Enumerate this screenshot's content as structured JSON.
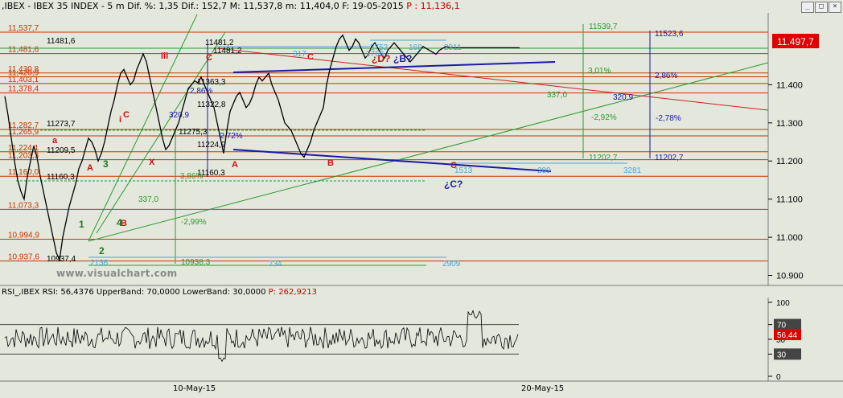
{
  "header": {
    "prefix": ",IBEX - IBEX 35 INDEX - 5 m Dif. %: 1,35 Dif.: 152,7 M: 11,537,8 m: 11,404,0 F: 19-05-2015",
    "last": "P : 11,136,1"
  },
  "window_controls": [
    "_",
    "□",
    "×"
  ],
  "watermark": "www.visualchart.com",
  "colors": {
    "background": "#e3e7dc",
    "price_line": "#000000",
    "support_lines": "#cc3300",
    "blue_lines": "#1a1aa8",
    "green_lines": "#2f9a2f",
    "red_trend": "#d02020",
    "cyan_lines": "#4aa6d8",
    "price_badge": "#e00000"
  },
  "price_axis": {
    "ticks": [
      11.4,
      11.3,
      11.2,
      11.1,
      11.0,
      10.9
    ],
    "tick_labels": [
      "11.400",
      "11.300",
      "11.200",
      "11.100",
      "11.000",
      "10.900"
    ],
    "current_price": "11.497,7"
  },
  "rsi_header": {
    "prefix": "RSI_,IBEX RSI: 56,4376 UpperBand: 70,0000 LowerBand: 30,0000",
    "last": "P: 262,9213"
  },
  "rsi_axis": {
    "ticks": [
      100,
      70,
      50,
      30,
      0
    ],
    "tick_labels": [
      "100",
      "70",
      "50",
      "30",
      "0"
    ],
    "badges": [
      "70",
      "56,44",
      "30"
    ]
  },
  "x_axis": {
    "labels": [
      "10-May-15",
      "20-May-15"
    ]
  },
  "horizontal_levels": [
    {
      "label": "11,537,7",
      "value": 11537.7
    },
    {
      "label": "11,481,6",
      "value": 11481.6
    },
    {
      "label": "11,420,9",
      "value": 11420.9
    },
    {
      "label": "11,430,8",
      "value": 11430.8
    },
    {
      "label": "11,403,1",
      "value": 11403.1
    },
    {
      "label": "11,378,4",
      "value": 11378.4
    },
    {
      "label": "11,282,7",
      "value": 11282.7
    },
    {
      "label": "11,265,9",
      "value": 11265.9
    },
    {
      "label": "11,224,1",
      "value": 11224.1
    },
    {
      "label": "11,203,3",
      "value": 11203.3
    },
    {
      "label": "11,160,0",
      "value": 11160.0
    },
    {
      "label": "11,073,3",
      "value": 11073.3
    },
    {
      "label": "10,994,9",
      "value": 10994.9
    },
    {
      "label": "10,937,6",
      "value": 10937.6
    }
  ],
  "annotations": {
    "black_values": [
      "11481,6",
      "11273,7",
      "11209,5",
      "11160,3",
      "10937,4",
      "11481,2",
      "11363,3",
      "11322,8",
      "11224,9",
      "11160,3",
      "11275,3",
      "11481,2"
    ],
    "wave_labels_red": [
      "A",
      "B",
      "C",
      "C",
      "B",
      "C",
      "A",
      "C",
      "iii",
      "i",
      "a",
      "X"
    ],
    "wave_labels_green": [
      "1",
      "2",
      "3",
      "4"
    ],
    "question_labels": [
      "¿D?",
      "¿B?",
      "¿C?"
    ],
    "percent_labels": [
      "3,01%",
      "2,86%",
      "-2,92%",
      "-2,78%",
      "-2,99%",
      "3,86%",
      "-2,72%",
      "2,86%"
    ],
    "measure_values": [
      "337,0",
      "320,9",
      "337,0",
      "320,9",
      "2752",
      "169",
      "2911",
      "2769",
      "734",
      "2909",
      "317",
      "289",
      "3281",
      "1513",
      "2136"
    ],
    "range_top_right": [
      "11539,7",
      "11523,6"
    ],
    "range_bottom_right": [
      "11202,7",
      "11202,7"
    ],
    "range_bottom_left": [
      "10938,3"
    ]
  },
  "chart_data": {
    "type": "line",
    "title": "IBEX 35 INDEX 5 m",
    "xlabel": "",
    "ylabel": "",
    "ylim": [
      10880,
      11580
    ],
    "grid": false,
    "price_series": {
      "name": "IBEX",
      "x": [
        0,
        4,
        8,
        12,
        16,
        20,
        24,
        28,
        32,
        36,
        40,
        44,
        48,
        52,
        56,
        60,
        64,
        68,
        72,
        76,
        80,
        84,
        88,
        92,
        96,
        100,
        104,
        108,
        112,
        116,
        120,
        124,
        128,
        132,
        136,
        140,
        144,
        148,
        152,
        156,
        160,
        164,
        168,
        172,
        176,
        180,
        184,
        188,
        192,
        196,
        200,
        204,
        208,
        212,
        216,
        220,
        224,
        228,
        232,
        236,
        240,
        244,
        248,
        252,
        256,
        260,
        264,
        268,
        272,
        276,
        280,
        284,
        288,
        292,
        296,
        300,
        304,
        308,
        312,
        316,
        320,
        324,
        328,
        332,
        336,
        340,
        344,
        348,
        352,
        356,
        360,
        364,
        368,
        372,
        376,
        380,
        384,
        388,
        392,
        396,
        400,
        404,
        408,
        412,
        416,
        420,
        424,
        428,
        432,
        436,
        440,
        444,
        448,
        452,
        456,
        460,
        464,
        468,
        472,
        476,
        480,
        484,
        488,
        492,
        496,
        500,
        504,
        508,
        512,
        516,
        520,
        524,
        528,
        532,
        536,
        540,
        544,
        548,
        552,
        556,
        560,
        564,
        568,
        572,
        576,
        580,
        584,
        588,
        592,
        596,
        600,
        604,
        608,
        612,
        616,
        620,
        624,
        628,
        632,
        636,
        640
      ],
      "values": [
        11370,
        11320,
        11260,
        11200,
        11150,
        11120,
        11100,
        11160,
        11200,
        11240,
        11210,
        11160,
        11120,
        11080,
        11040,
        11000,
        10960,
        10940,
        11000,
        11040,
        11080,
        11110,
        11140,
        11180,
        11200,
        11230,
        11260,
        11250,
        11230,
        11200,
        11220,
        11250,
        11290,
        11330,
        11360,
        11400,
        11430,
        11440,
        11420,
        11400,
        11410,
        11440,
        11460,
        11481,
        11460,
        11420,
        11380,
        11340,
        11300,
        11260,
        11230,
        11240,
        11260,
        11280,
        11300,
        11330,
        11360,
        11390,
        11400,
        11410,
        11405,
        11420,
        11400,
        11380,
        11360,
        11340,
        11300,
        11260,
        11220,
        11280,
        11330,
        11350,
        11370,
        11380,
        11360,
        11340,
        11350,
        11370,
        11400,
        11420,
        11410,
        11420,
        11430,
        11400,
        11380,
        11360,
        11330,
        11300,
        11290,
        11280,
        11260,
        11240,
        11220,
        11210,
        11230,
        11250,
        11280,
        11300,
        11320,
        11340,
        11400,
        11440,
        11470,
        11500,
        11520,
        11530,
        11510,
        11490,
        11500,
        11520,
        11510,
        11490,
        11470,
        11480,
        11500,
        11510,
        11495,
        11480,
        11470,
        11490,
        11500,
        11510,
        11500,
        11490,
        11480,
        11470,
        11460,
        11470,
        11480,
        11490,
        11500,
        11495,
        11490,
        11485,
        11480,
        11490,
        11495,
        11500,
        11498,
        11497,
        11497,
        11497,
        11497,
        11497,
        11497,
        11497,
        11497,
        11497,
        11497,
        11497,
        11497,
        11497,
        11497,
        11497,
        11497,
        11497,
        11497,
        11497,
        11497,
        11497,
        11497
      ]
    },
    "rsi_series": {
      "name": "RSI",
      "bands": [
        70,
        30
      ],
      "last": 56.44
    }
  }
}
